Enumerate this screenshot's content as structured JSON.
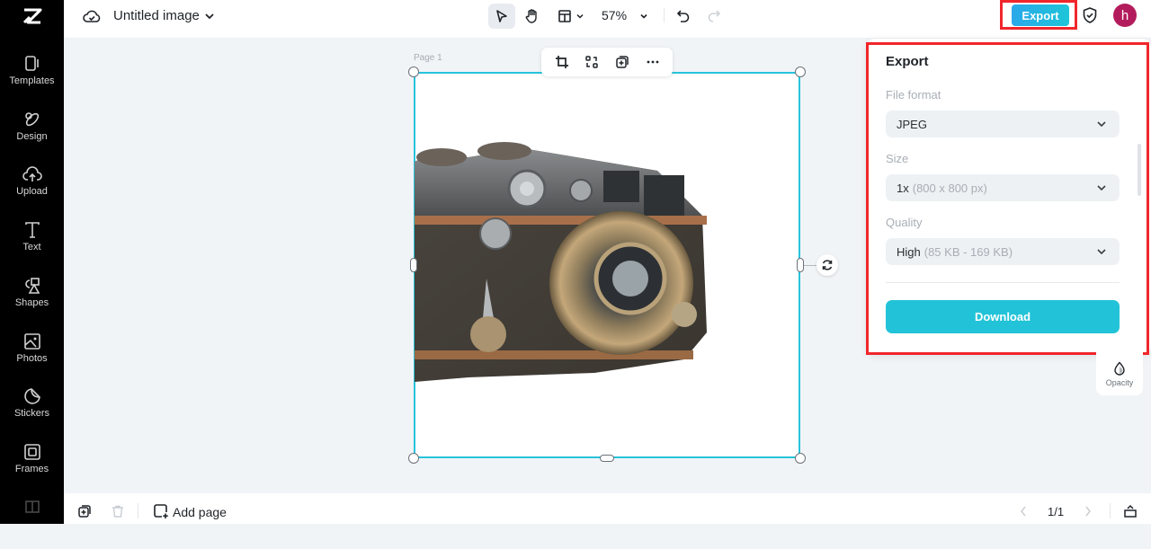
{
  "app": {
    "document_title": "Untitled image",
    "zoom_level": "57%"
  },
  "sidebar": {
    "items": [
      {
        "label": "Templates",
        "icon": "templates-icon"
      },
      {
        "label": "Design",
        "icon": "design-icon"
      },
      {
        "label": "Upload",
        "icon": "upload-icon"
      },
      {
        "label": "Text",
        "icon": "text-icon"
      },
      {
        "label": "Shapes",
        "icon": "shapes-icon"
      },
      {
        "label": "Photos",
        "icon": "photos-icon"
      },
      {
        "label": "Stickers",
        "icon": "stickers-icon"
      },
      {
        "label": "Frames",
        "icon": "frames-icon"
      }
    ]
  },
  "header": {
    "export_label": "Export",
    "avatar_initial": "h"
  },
  "canvas": {
    "page_label": "Page 1"
  },
  "export_panel": {
    "title": "Export",
    "file_format": {
      "label": "File format",
      "value": "JPEG"
    },
    "size": {
      "label": "Size",
      "value": "1x",
      "detail": "(800 x 800 px)"
    },
    "quality": {
      "label": "Quality",
      "value": "High",
      "detail": "(85 KB - 169 KB)"
    },
    "download_label": "Download"
  },
  "side_tools": {
    "opacity_label": "Opacity"
  },
  "bottom": {
    "add_page_label": "Add page",
    "page_count": "1/1"
  },
  "colors": {
    "accent": "#22c3d8",
    "selection": "#27c3da",
    "highlight": "#f0262b",
    "avatar": "#b31c5c"
  }
}
